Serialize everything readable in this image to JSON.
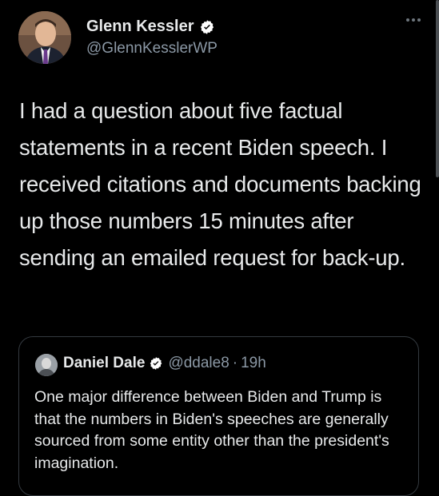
{
  "tweet": {
    "author": {
      "name": "Glenn Kessler",
      "handle": "@GlennKesslerWP",
      "verified": true,
      "avatar": "profile-photo"
    },
    "more_icon": "more-horizontal-icon",
    "text": "I had a question about five factual statements in a recent Biden speech. I received citations and documents backing up those numbers 15 minutes after sending an emailed request for back-up."
  },
  "quoted_tweet": {
    "author": {
      "name": "Daniel Dale",
      "handle": "@ddale8",
      "verified": true,
      "avatar": "profile-photo"
    },
    "separator": "·",
    "time": "19h",
    "text": "One major difference between Biden and Trump is that the numbers in Biden's speeches are generally sourced from some entity other than the president's imagination."
  },
  "colors": {
    "background": "#000000",
    "text": "#e7e9ea",
    "secondary_text": "#8b98a5",
    "border": "#343a40",
    "verified_badge": "#ffffff"
  }
}
